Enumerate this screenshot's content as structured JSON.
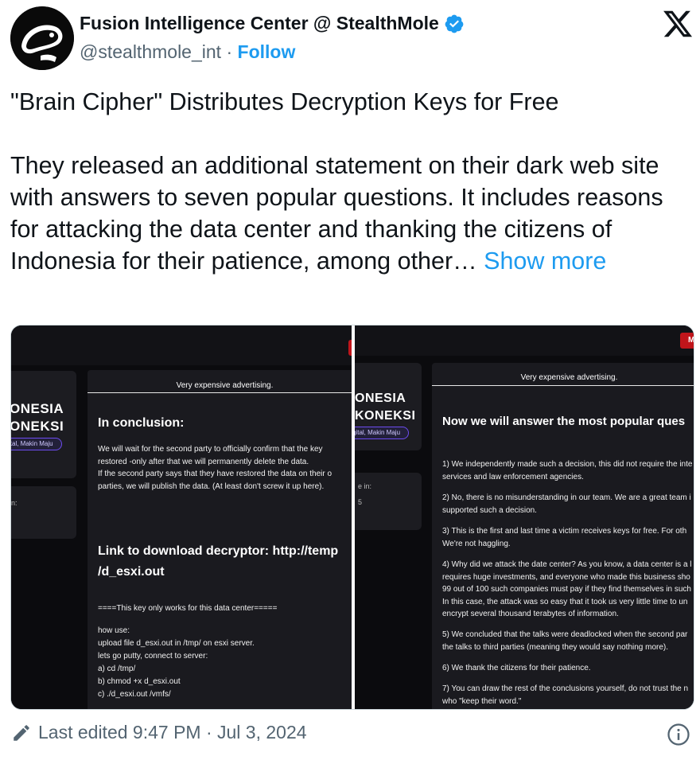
{
  "author": {
    "name": "Fusion Intelligence Center @ StealthMole",
    "handle": "@stealthmole_int",
    "separator": "·",
    "follow_label": "Follow",
    "verified_color": "#1d9bf0"
  },
  "tweet": {
    "text": "\"Brain Cipher\" Distributes Decryption Keys for Free\n\nThey released an additional statement on their dark web site with answers to seven popular questions. It includes reasons for attacking the data center and thanking the citizens of Indonesia for their patience, among other… ",
    "show_more_label": "Show more"
  },
  "media": {
    "left": {
      "brand_line1": "ONESIA",
      "brand_line2": "ONEKSI",
      "pill_text": "ital, Makin Maju",
      "side_label": "n:",
      "header": "Very expensive advertising.",
      "conclusion_title": "In conclusion:",
      "conclusion_body": "We will wait for the second party to officially confirm that the key\nrestored -only after that we will permanently delete the data.\nIf the second party says that they have restored the data on their o\nparties, we will publish the data. (At least don't screw it up here).",
      "link_title_line1": "Link to download decryptor: http://temp",
      "link_title_line2": "/d_esxi.out",
      "key_note": "====This key only works for this data center=====",
      "howto": "how use:\nupload file d_esxi.out in /tmp/ on esxi server.\nlets go putty, connect to server:\na) cd /tmp/\nb) chmod +x d_esxi.out\nc) ./d_esxi.out /vmfs/"
    },
    "right": {
      "button_text": "Ma",
      "brand_line1": "ONESIA",
      "brand_line2": "KONEKSI",
      "pill_text": "gital, Makin Maju",
      "side_label_1": "e in:",
      "side_label_2": "5",
      "header": "Very expensive advertising.",
      "title": "Now we will answer the most popular ques",
      "answers": [
        "1) We independently made such a decision, this did not require the inte\nservices and law enforcement agencies.",
        "2) No, there is no misunderstanding in our team. We are a great team i\nsupported such a decision.",
        "3) This is the first and last time a victim receives keys for free. For oth\nWe're not haggling.",
        "4) Why did we attack the date center? As you know, a data center is a l\nrequires huge investments, and everyone who made this business sho\n99 out of 100 such companies must pay if they find themselves in such\nIn this case, the attack was so easy that it took us very little time to un\nencrypt several thousand terabytes of information.",
        "5) We concluded that the talks were deadlocked when the second par\nthe talks to third parties (meaning they would say nothing more).",
        "6) We thank the citizens for their patience.",
        "7) You can draw the rest of the conclusions yourself, do not trust the n\nwho \"keep their word.\""
      ]
    }
  },
  "footer": {
    "edited_label": "Last edited 9:47 PM · Jul 3, 2024"
  },
  "icons": {
    "verified": "verified-badge-icon",
    "x_logo": "x-logo-icon",
    "edit": "pencil-icon",
    "info": "info-icon"
  }
}
